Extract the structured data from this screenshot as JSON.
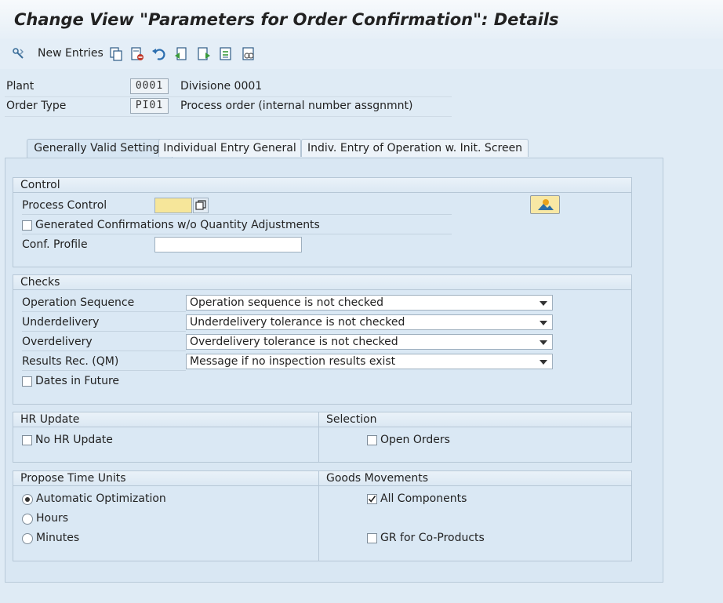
{
  "title": "Change View \"Parameters for Order Confirmation\": Details",
  "toolbar": {
    "new_entries_label": "New Entries",
    "icons": [
      "display-change-icon",
      "copy-icon",
      "delete-icon",
      "undo-icon",
      "previous-entry-icon",
      "next-entry-icon",
      "select-all-icon",
      "deselect-icon"
    ]
  },
  "header": {
    "plant_label": "Plant",
    "plant_value": "0001",
    "plant_desc": "Divisione 0001",
    "order_type_label": "Order Type",
    "order_type_value": "PI01",
    "order_type_desc": "Process order (internal number assgnmnt)"
  },
  "tabs": [
    {
      "label": "Generally Valid Settings",
      "active": true
    },
    {
      "label": "Individual Entry General",
      "active": false
    },
    {
      "label": "Indiv. Entry of Operation w. Init. Screen",
      "active": false
    }
  ],
  "control": {
    "header": "Control",
    "process_control_label": "Process Control",
    "process_control_value": "",
    "gen_conf_label": "Generated Confirmations w/o Quantity Adjustments",
    "gen_conf_checked": false,
    "conf_profile_label": "Conf. Profile",
    "conf_profile_value": ""
  },
  "checks": {
    "header": "Checks",
    "rows": [
      {
        "label": "Operation Sequence",
        "value": "Operation sequence is not checked"
      },
      {
        "label": "Underdelivery",
        "value": "Underdelivery tolerance is not checked"
      },
      {
        "label": "Overdelivery",
        "value": "Overdelivery tolerance is not checked"
      },
      {
        "label": "Results Rec. (QM)",
        "value": "Message if no inspection results exist"
      }
    ],
    "dates_future_label": "Dates in Future",
    "dates_future_checked": false
  },
  "hr_update": {
    "header": "HR Update",
    "no_hr_label": "No HR Update",
    "no_hr_checked": false
  },
  "selection": {
    "header": "Selection",
    "open_orders_label": "Open Orders",
    "open_orders_checked": false
  },
  "time_units": {
    "header": "Propose Time Units",
    "options": [
      "Automatic Optimization",
      "Hours",
      "Minutes"
    ],
    "selected": "Automatic Optimization"
  },
  "goods_movements": {
    "header": "Goods Movements",
    "all_components_label": "All Components",
    "all_components_checked": true,
    "gr_coproducts_label": "GR for Co-Products",
    "gr_coproducts_checked": false
  },
  "colors": {
    "accent": "#f6e69a",
    "panel": "#d9e7f3"
  }
}
